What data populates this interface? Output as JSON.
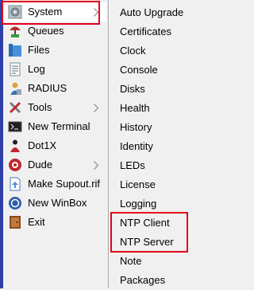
{
  "main_menu": {
    "items": [
      {
        "label": "System",
        "icon": "gear-icon",
        "has_submenu": true
      },
      {
        "label": "Queues",
        "icon": "queues-icon",
        "has_submenu": false
      },
      {
        "label": "Files",
        "icon": "folder-icon",
        "has_submenu": false
      },
      {
        "label": "Log",
        "icon": "log-icon",
        "has_submenu": false
      },
      {
        "label": "RADIUS",
        "icon": "radius-icon",
        "has_submenu": false
      },
      {
        "label": "Tools",
        "icon": "tools-icon",
        "has_submenu": true
      },
      {
        "label": "New Terminal",
        "icon": "terminal-icon",
        "has_submenu": false
      },
      {
        "label": "Dot1X",
        "icon": "dot1x-icon",
        "has_submenu": false
      },
      {
        "label": "Dude",
        "icon": "dude-icon",
        "has_submenu": true
      },
      {
        "label": "Make Supout.rif",
        "icon": "supout-icon",
        "has_submenu": false
      },
      {
        "label": "New WinBox",
        "icon": "winbox-icon",
        "has_submenu": false
      },
      {
        "label": "Exit",
        "icon": "exit-icon",
        "has_submenu": false
      }
    ]
  },
  "submenu": {
    "items": [
      {
        "label": "Auto Upgrade"
      },
      {
        "label": "Certificates"
      },
      {
        "label": "Clock"
      },
      {
        "label": "Console"
      },
      {
        "label": "Disks"
      },
      {
        "label": "Health"
      },
      {
        "label": "History"
      },
      {
        "label": "Identity"
      },
      {
        "label": "LEDs"
      },
      {
        "label": "License"
      },
      {
        "label": "Logging"
      },
      {
        "label": "NTP Client"
      },
      {
        "label": "NTP Server"
      },
      {
        "label": "Note"
      },
      {
        "label": "Packages"
      }
    ]
  },
  "colors": {
    "highlight": "#e2001a",
    "left_accent": "#2f3fa8",
    "menu_bg": "#f0f0f0"
  }
}
